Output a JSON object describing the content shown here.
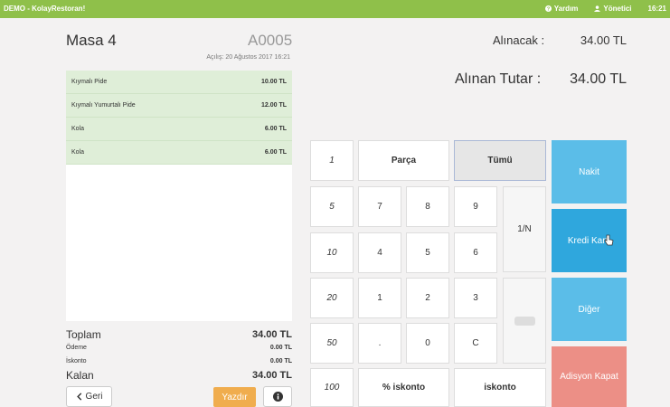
{
  "topbar": {
    "brand": "DEMO - KolayRestoran!",
    "help_label": "Yardım",
    "user_label": "Yönetici",
    "time": "16:21"
  },
  "order": {
    "title": "Masa 4",
    "number": "A0005",
    "opened": "Açılış: 20 Ağustos 2017 16:21",
    "items": [
      {
        "name": "Kıymalı Pide",
        "price": "10.00 TL"
      },
      {
        "name": "Kıymalı Yumurtalı Pide",
        "price": "12.00 TL"
      },
      {
        "name": "Kola",
        "price": "6.00 TL"
      },
      {
        "name": "Kola",
        "price": "6.00 TL"
      }
    ]
  },
  "totals": {
    "total_label": "Toplam",
    "total_value": "34.00 TL",
    "payment_label": "Ödeme",
    "payment_value": "0.00 TL",
    "discount_label": "İskonto",
    "discount_value": "0.00 TL",
    "remaining_label": "Kalan",
    "remaining_value": "34.00 TL"
  },
  "buttons": {
    "back": "Geri",
    "print": "Yazdır"
  },
  "summary": {
    "to_receive_label": "Alınacak :",
    "to_receive_value": "34.00 TL",
    "received_label": "Alınan Tutar :",
    "received_value": "34.00 TL"
  },
  "keypad": {
    "q1": "1",
    "part": "Parça",
    "all": "Tümü",
    "q5": "5",
    "q10": "10",
    "q20": "20",
    "q50": "50",
    "q100": "100",
    "k7": "7",
    "k8": "8",
    "k9": "9",
    "k4": "4",
    "k5": "5",
    "k6": "6",
    "k1": "1",
    "k2": "2",
    "k3": "3",
    "dot": ".",
    "k0": "0",
    "clear": "C",
    "split": "1/N",
    "pct_discount": "% iskonto",
    "discount": "iskonto"
  },
  "payment": {
    "cash": "Nakit",
    "card": "Kredi Kartı",
    "other": "Diğer",
    "close": "Adisyon Kapat"
  },
  "colors": {
    "topbar": "#8fc04a",
    "item_row": "#dfeed8",
    "print": "#f0ad4e",
    "pay_blue": "#5bbde8",
    "pay_blue_active": "#2fa7dd",
    "close_red": "#ec8f86"
  }
}
